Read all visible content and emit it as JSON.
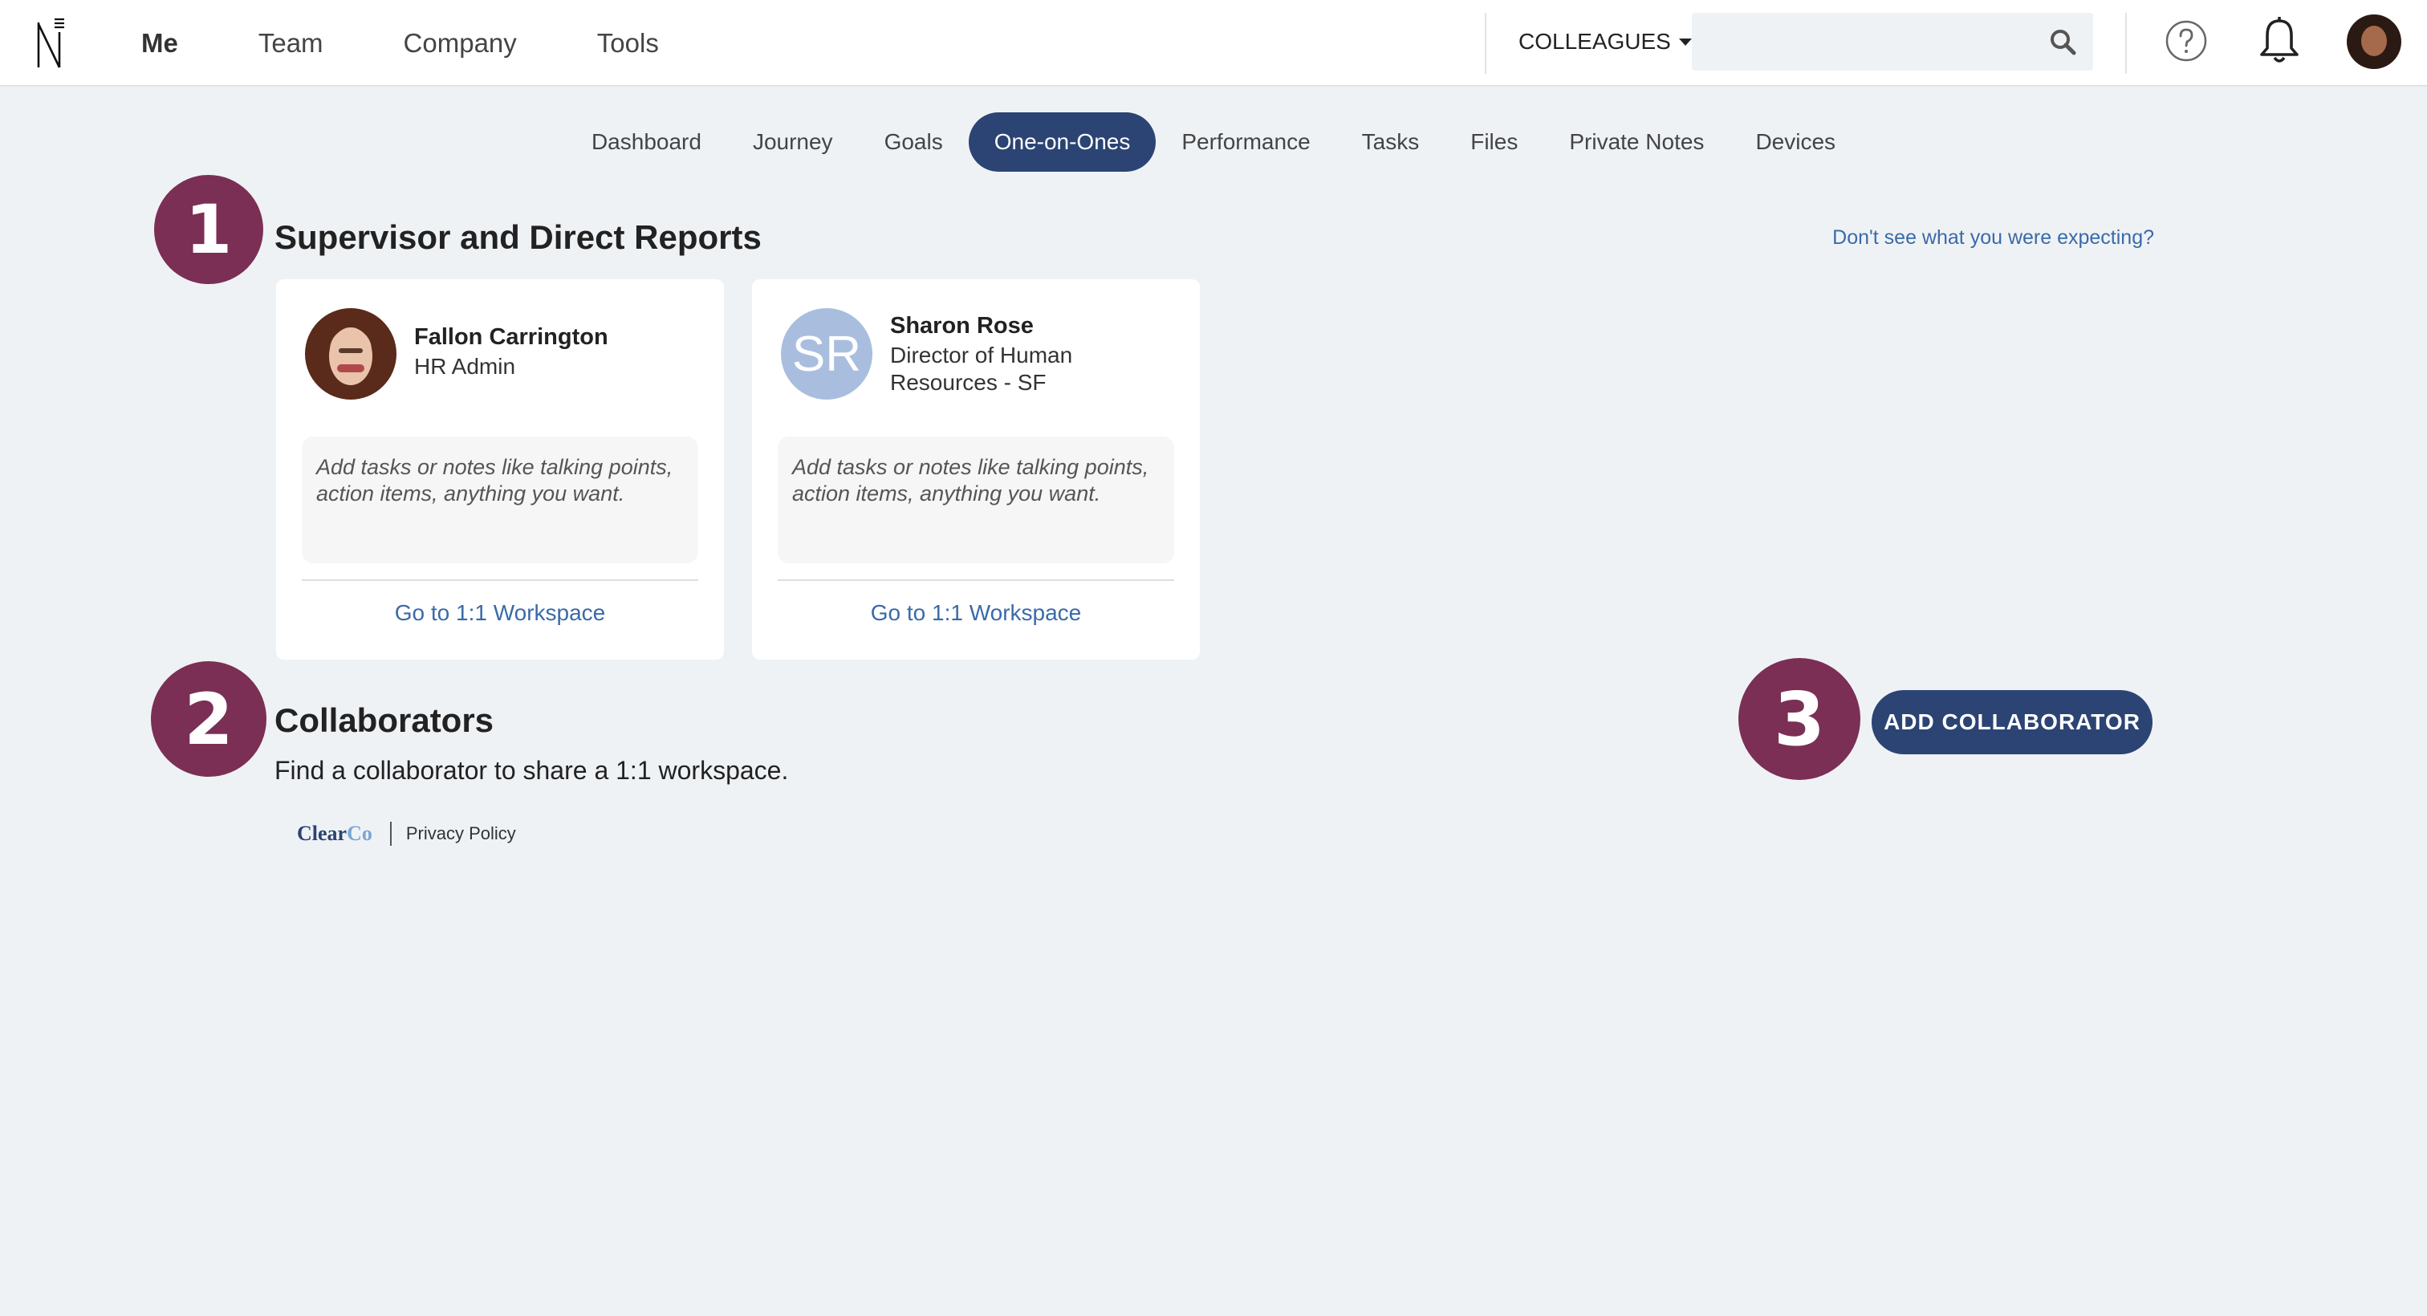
{
  "topbar": {
    "nav": [
      "Me",
      "Team",
      "Company",
      "Tools"
    ],
    "active_nav": "Me",
    "colleagues_label": "COLLEAGUES",
    "search_placeholder": "",
    "icons": [
      "logo-icon",
      "search-icon",
      "help-icon",
      "bell-icon",
      "avatar"
    ]
  },
  "subnav": {
    "tabs": [
      "Dashboard",
      "Journey",
      "Goals",
      "One-on-Ones",
      "Performance",
      "Tasks",
      "Files",
      "Private Notes",
      "Devices"
    ],
    "active_tab": "One-on-Ones"
  },
  "markers": [
    "1",
    "2",
    "3"
  ],
  "section1": {
    "title": "Supervisor and Direct Reports",
    "help_link": "Don't see what you were expecting?",
    "cards": [
      {
        "name": "Fallon Carrington",
        "role": "HR Admin",
        "notes_placeholder": "Add tasks or notes like talking points, action items, anything you want.",
        "link": "Go to 1:1 Workspace"
      },
      {
        "initials": "SR",
        "name": "Sharon Rose",
        "role": "Director of Human Resources - SF",
        "notes_placeholder": "Add tasks or notes like talking points, action items, anything you want.",
        "link": "Go to 1:1 Workspace"
      }
    ]
  },
  "section2": {
    "title": "Collaborators",
    "subtitle": "Find a collaborator to share a 1:1 workspace.",
    "button": "ADD COLLABORATOR"
  },
  "footer": {
    "brand_main": "Clear",
    "brand_accent": "Co",
    "privacy": "Privacy Policy"
  },
  "colors": {
    "accent_navy": "#2b4474",
    "marker_plum": "#7b2f55",
    "link_blue": "#3a6aa8",
    "background": "#eff2f5"
  }
}
